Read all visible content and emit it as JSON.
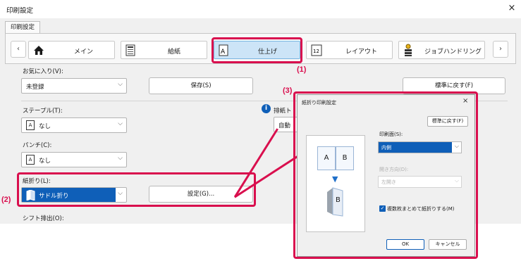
{
  "window": {
    "title": "印刷設定",
    "close_icon": "×"
  },
  "tab": {
    "label": "印刷設定"
  },
  "toolbar": {
    "prev_icon": "‹",
    "next_icon": "›",
    "tabs": [
      {
        "label": "メイン",
        "icon": "home-icon"
      },
      {
        "label": "給紙",
        "icon": "printer-tray-icon"
      },
      {
        "label": "仕上げ",
        "icon": "finishing-icon"
      },
      {
        "label": "レイアウト",
        "icon": "layout-icon"
      },
      {
        "label": "ジョブハンドリング",
        "icon": "job-handling-icon"
      }
    ]
  },
  "favorites": {
    "label": "お気に入り(V):",
    "value": "未登録",
    "save_label": "保存(S)",
    "reset_label": "標準に戻す(F)"
  },
  "staple": {
    "label": "ステープル(T):",
    "value": "なし"
  },
  "punch": {
    "label": "パンチ(C):",
    "value": "なし"
  },
  "fold": {
    "label": "紙折り(L):",
    "value": "サドル折り",
    "settings_label": "設定(G)..."
  },
  "shift": {
    "label": "シフト排出(O):"
  },
  "output": {
    "label": "排紙ト",
    "value": "自動"
  },
  "callouts": {
    "c1": "(1)",
    "c2": "(2)",
    "c3": "(3)"
  },
  "dialog": {
    "title": "紙折り印刷設定",
    "close_icon": "×",
    "reset_label": "標準に戻す(F)",
    "print_side_label": "印刷面(S):",
    "print_side_value": "内側",
    "open_dir_label": "開き方向(D):",
    "open_dir_value": "左開き",
    "checkbox_label": "複数枚まとめて紙折りする(M)",
    "checkbox_checked": true,
    "ok_label": "OK",
    "cancel_label": "キャンセル",
    "preview": {
      "page_a": "A",
      "page_b": "B",
      "folded_b": "B"
    }
  },
  "colors": {
    "accent": "#0f5fb8",
    "highlight": "#d90f4e",
    "selected_tab": "#cce4f7"
  }
}
